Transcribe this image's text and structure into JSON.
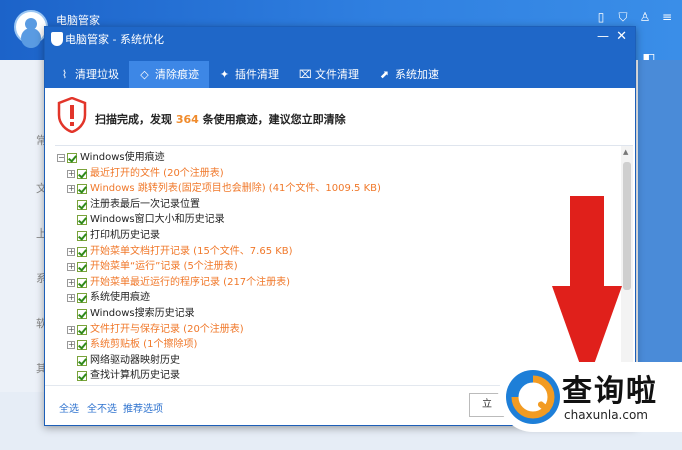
{
  "outer": {
    "app_name": "电脑管家",
    "left_items": [
      "常",
      "文",
      "上",
      "系",
      "软",
      "其"
    ]
  },
  "dialog": {
    "title": "电脑管家 - 系统优化",
    "tabs": [
      {
        "label": "清理垃圾",
        "icon": "broom-icon",
        "active": false
      },
      {
        "label": "清除痕迹",
        "icon": "eraser-icon",
        "active": true
      },
      {
        "label": "插件清理",
        "icon": "puzzle-icon",
        "active": false
      },
      {
        "label": "文件清理",
        "icon": "trash-icon",
        "active": false
      },
      {
        "label": "系统加速",
        "icon": "speed-icon",
        "active": false
      }
    ],
    "alert": {
      "prefix": "扫描完成，发现 ",
      "count": "364",
      "suffix": " 条使用痕迹，建议您立即清除"
    },
    "tree": [
      {
        "label": "Windows使用痕迹",
        "level": 0,
        "expander": "−",
        "orange": false
      },
      {
        "label": "最近打开的文件 (20个注册表)",
        "level": 1,
        "expander": "+",
        "orange": true
      },
      {
        "label": "Windows 跳转列表(固定项目也会删除) (41个文件、1009.5 KB)",
        "level": 1,
        "expander": "+",
        "orange": true
      },
      {
        "label": "注册表最后一次记录位置",
        "level": 1,
        "expander": "",
        "orange": false
      },
      {
        "label": "Windows窗口大小和历史记录",
        "level": 1,
        "expander": "",
        "orange": false
      },
      {
        "label": "打印机历史记录",
        "level": 1,
        "expander": "",
        "orange": false
      },
      {
        "label": "开始菜单文档打开记录 (15个文件、7.65 KB)",
        "level": 1,
        "expander": "+",
        "orange": true
      },
      {
        "label": "开始菜单“运行”记录 (5个注册表)",
        "level": 1,
        "expander": "+",
        "orange": true
      },
      {
        "label": "开始菜单最近运行的程序记录 (217个注册表)",
        "level": 1,
        "expander": "+",
        "orange": true
      },
      {
        "label": "系统使用痕迹",
        "level": 1,
        "expander": "+",
        "orange": false
      },
      {
        "label": "Windows搜索历史记录",
        "level": 1,
        "expander": "",
        "orange": false
      },
      {
        "label": "文件打开与保存记录 (20个注册表)",
        "level": 1,
        "expander": "+",
        "orange": true
      },
      {
        "label": "系统剪贴板 (1个擦除项)",
        "level": 1,
        "expander": "+",
        "orange": true
      },
      {
        "label": "网络驱动器映射历史",
        "level": 1,
        "expander": "",
        "orange": false
      },
      {
        "label": "查找计算机历史记录",
        "level": 1,
        "expander": "",
        "orange": false
      }
    ],
    "footer": {
      "select_all": "全选",
      "select_none": "全不选",
      "recommended": "推荐选项",
      "button": "立"
    }
  },
  "watermark": {
    "text": "查询啦",
    "url": "chaxunla.com"
  },
  "colors": {
    "title_blue": "#1f67c8",
    "active_tab": "#3d87e6",
    "orange_text": "#f0782a",
    "arrow_red": "#e0201b"
  }
}
